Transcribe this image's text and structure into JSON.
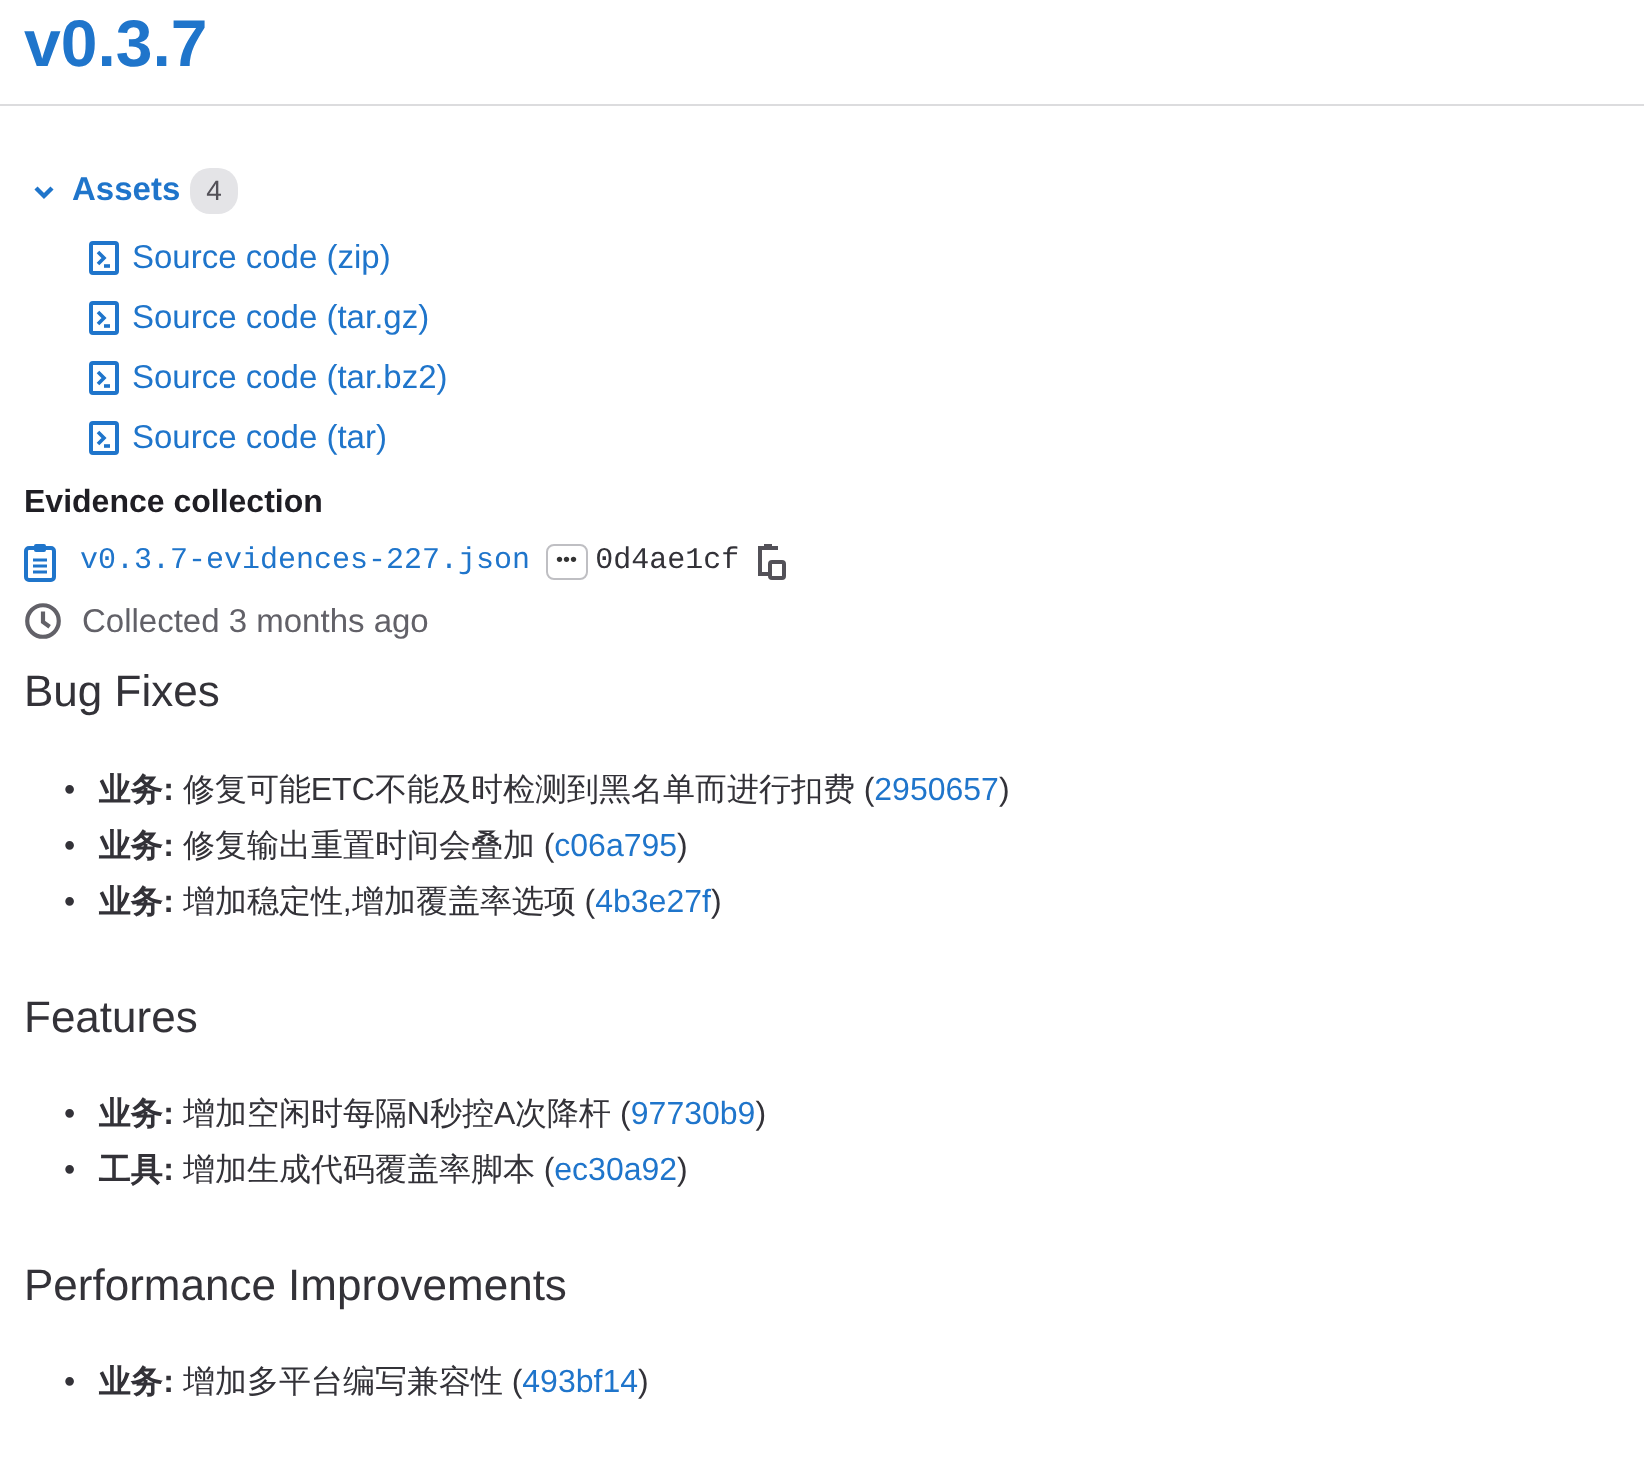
{
  "release": {
    "title": "v0.3.7"
  },
  "assets": {
    "label": "Assets",
    "count": "4",
    "expanded": true,
    "links": [
      {
        "label": "Source code (zip)"
      },
      {
        "label": "Source code (tar.gz)"
      },
      {
        "label": "Source code (tar.bz2)"
      },
      {
        "label": "Source code (tar)"
      }
    ]
  },
  "evidence": {
    "heading": "Evidence collection",
    "file": "v0.3.7-evidences-227.json",
    "toggle": "•••",
    "sha": "0d4ae1cf",
    "collected": "Collected 3 months ago"
  },
  "sections": [
    {
      "heading": "Bug Fixes",
      "items": [
        {
          "bullet": "•",
          "scope": "业务:",
          "text": " 修复可能ETC不能及时检测到黑名单而进行扣费 (",
          "commit": "2950657",
          "after": ")"
        },
        {
          "bullet": "•",
          "scope": "业务:",
          "text": " 修复输出重置时间会叠加 (",
          "commit": "c06a795",
          "after": ")"
        },
        {
          "bullet": "•",
          "scope": "业务:",
          "text": " 增加稳定性,增加覆盖率选项 (",
          "commit": "4b3e27f",
          "after": ")"
        }
      ]
    },
    {
      "heading": "Features",
      "items": [
        {
          "bullet": "•",
          "scope": "业务:",
          "text": " 增加空闲时每隔N秒控A次降杆 (",
          "commit": "97730b9",
          "after": ")"
        },
        {
          "bullet": "•",
          "scope": "工具:",
          "text": " 增加生成代码覆盖率脚本 (",
          "commit": "ec30a92",
          "after": ")"
        }
      ]
    },
    {
      "heading": "Performance Improvements",
      "items": [
        {
          "bullet": "•",
          "scope": "业务:",
          "text": " 增加多平台编写兼容性 (",
          "commit": "493bf14",
          "after": ")"
        }
      ]
    }
  ]
}
